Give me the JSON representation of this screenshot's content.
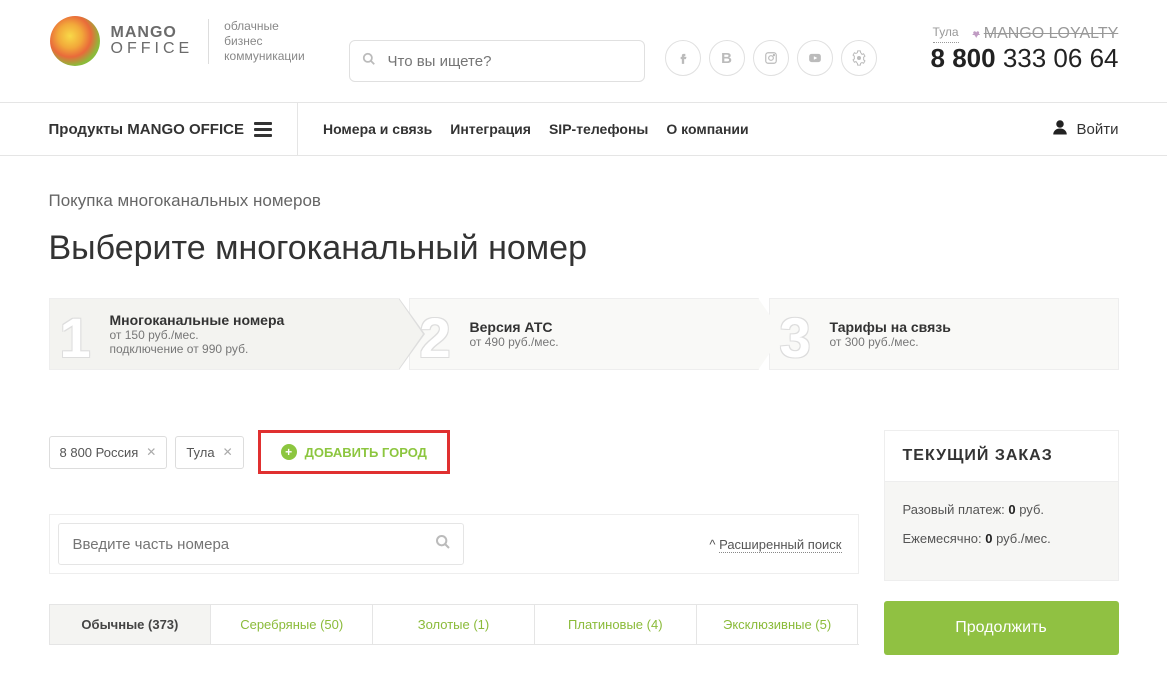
{
  "header": {
    "brand": "MANGO",
    "brand_sub": "OFFICE",
    "tagline_1": "облачные",
    "tagline_2": "бизнес",
    "tagline_3": "коммуникации",
    "search_placeholder": "Что вы ищете?",
    "city": "Тула",
    "loyalty": "MANGO LOYALTY",
    "phone_prefix": "8 800",
    "phone_rest": " 333 06 64"
  },
  "nav": {
    "products": "Продукты MANGO OFFICE",
    "items": [
      "Номера и связь",
      "Интеграция",
      "SIP-телефоны",
      "О компании"
    ],
    "login": "Войти"
  },
  "page": {
    "breadcrumb": "Покупка многоканальных номеров",
    "h1": "Выберите многоканальный номер"
  },
  "steps": [
    {
      "title": "Многоканальные номера",
      "line1": "от 150 руб./мес.",
      "line2": "подключение от 990 руб."
    },
    {
      "title": "Версия АТС",
      "line1": "от 490 руб./мес.",
      "line2": ""
    },
    {
      "title": "Тарифы на связь",
      "line1": "от 300 руб./мес.",
      "line2": ""
    }
  ],
  "chips": [
    "8 800 Россия",
    "Тула"
  ],
  "add_city": "ДОБАВИТЬ ГОРОД",
  "num_search_placeholder": "Введите часть номера",
  "adv_search_prefix": "^ ",
  "adv_search": "Расширенный поиск",
  "tabs": [
    {
      "label": "Обычные (373)",
      "active": true
    },
    {
      "label": "Серебряные (50)",
      "active": false
    },
    {
      "label": "Золотые (1)",
      "active": false
    },
    {
      "label": "Платиновые (4)",
      "active": false
    },
    {
      "label": "Эксклюзивные (5)",
      "active": false
    }
  ],
  "order": {
    "hdr": "ТЕКУЩИЙ ЗАКАЗ",
    "row1_label": "Разовый платеж: ",
    "row1_val": "0",
    "row1_suffix": " руб.",
    "row2_label": "Ежемесячно: ",
    "row2_val": "0",
    "row2_suffix": " руб./мес.",
    "continue": "Продолжить"
  }
}
